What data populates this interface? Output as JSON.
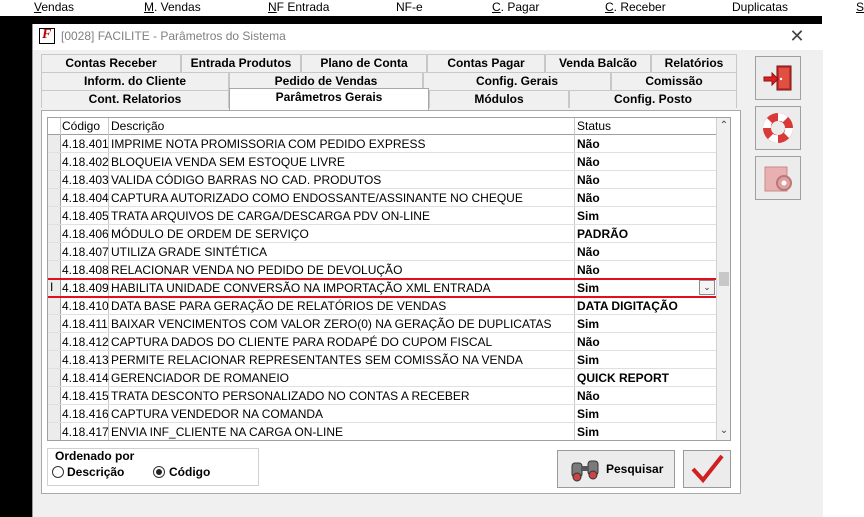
{
  "menu": {
    "vendas": {
      "u": "V",
      "rest": "endas"
    },
    "m_vendas": {
      "u": "M",
      "rest": ". Vendas"
    },
    "nf_entrada": {
      "u": "N",
      "rest": "F Entrada"
    },
    "nfe": {
      "u": "",
      "rest": "NF-e"
    },
    "c_pagar": {
      "u": "C",
      "rest": ". Pagar"
    },
    "c_receber": {
      "u": "C",
      "rest": ". Receber"
    },
    "duplicatas": {
      "u": "",
      "rest": "Duplicatas"
    },
    "s": {
      "u": "S",
      "rest": ""
    }
  },
  "window": {
    "title": "[0028] FACILITE - Parâmetros do Sistema",
    "close": "✕"
  },
  "tabs": {
    "row1": [
      "Contas Receber",
      "Entrada Produtos",
      "Plano de Conta",
      "Contas Pagar",
      "Venda Balcão",
      "Relatórios"
    ],
    "row2": [
      "Inform. do Cliente",
      "Pedido de Vendas",
      "Config. Gerais",
      "Comissão"
    ],
    "row3": [
      "Cont. Relatorios",
      "Parâmetros Gerais",
      "Módulos",
      "Config. Posto"
    ]
  },
  "grid": {
    "headers": {
      "codigo": "Código",
      "descricao": "Descrição",
      "status": "Status"
    },
    "current_marker": "I",
    "rows": [
      {
        "codigo": "4.18.401",
        "descricao": "IMPRIME NOTA PROMISSORIA COM PEDIDO EXPRESS",
        "status": "Não"
      },
      {
        "codigo": "4.18.402",
        "descricao": "BLOQUEIA VENDA SEM ESTOQUE LIVRE",
        "status": "Não"
      },
      {
        "codigo": "4.18.403",
        "descricao": "VALIDA CÓDIGO BARRAS NO CAD. PRODUTOS",
        "status": "Não"
      },
      {
        "codigo": "4.18.404",
        "descricao": "CAPTURA AUTORIZADO COMO ENDOSSANTE/ASSINANTE NO CHEQUE",
        "status": "Não"
      },
      {
        "codigo": "4.18.405",
        "descricao": "TRATA ARQUIVOS DE CARGA/DESCARGA PDV ON-LINE",
        "status": "Sim"
      },
      {
        "codigo": "4.18.406",
        "descricao": "MÓDULO DE ORDEM DE SERVIÇO",
        "status": "PADRÃO"
      },
      {
        "codigo": "4.18.407",
        "descricao": "UTILIZA GRADE SINTÉTICA",
        "status": "Não"
      },
      {
        "codigo": "4.18.408",
        "descricao": "RELACIONAR VENDA NO PEDIDO DE DEVOLUÇÃO",
        "status": "Não"
      },
      {
        "codigo": "4.18.409",
        "descricao": "HABILITA UNIDADE CONVERSÃO NA IMPORTAÇÃO XML ENTRADA",
        "status": "Sim"
      },
      {
        "codigo": "4.18.410",
        "descricao": "DATA BASE PARA GERAÇÃO DE RELATÓRIOS DE VENDAS",
        "status": "DATA DIGITAÇÃO"
      },
      {
        "codigo": "4.18.411",
        "descricao": "BAIXAR VENCIMENTOS COM VALOR ZERO(0) NA GERAÇÃO DE DUPLICATAS",
        "status": "Sim"
      },
      {
        "codigo": "4.18.412",
        "descricao": "CAPTURA DADOS DO CLIENTE PARA RODAPÉ DO CUPOM FISCAL",
        "status": "Não"
      },
      {
        "codigo": "4.18.413",
        "descricao": "PERMITE RELACIONAR REPRESENTANTES SEM COMISSÃO NA VENDA",
        "status": "Sim"
      },
      {
        "codigo": "4.18.414",
        "descricao": "GERENCIADOR DE ROMANEIO",
        "status": "QUICK REPORT"
      },
      {
        "codigo": "4.18.415",
        "descricao": "TRATA DESCONTO PERSONALIZADO NO CONTAS A RECEBER",
        "status": "Não"
      },
      {
        "codigo": "4.18.416",
        "descricao": "CAPTURA VENDEDOR NA COMANDA",
        "status": "Sim"
      },
      {
        "codigo": "4.18.417",
        "descricao": "ENVIA INF_CLIENTE NA CARGA ON-LINE",
        "status": "Sim"
      }
    ]
  },
  "order": {
    "label": "Ordenado por",
    "opt1": "Descrição",
    "opt2": "Código",
    "selected": "Código"
  },
  "buttons": {
    "pesquisar": "Pesquisar"
  },
  "colors": {
    "highlight": "#e01020",
    "check": "#d02020"
  }
}
